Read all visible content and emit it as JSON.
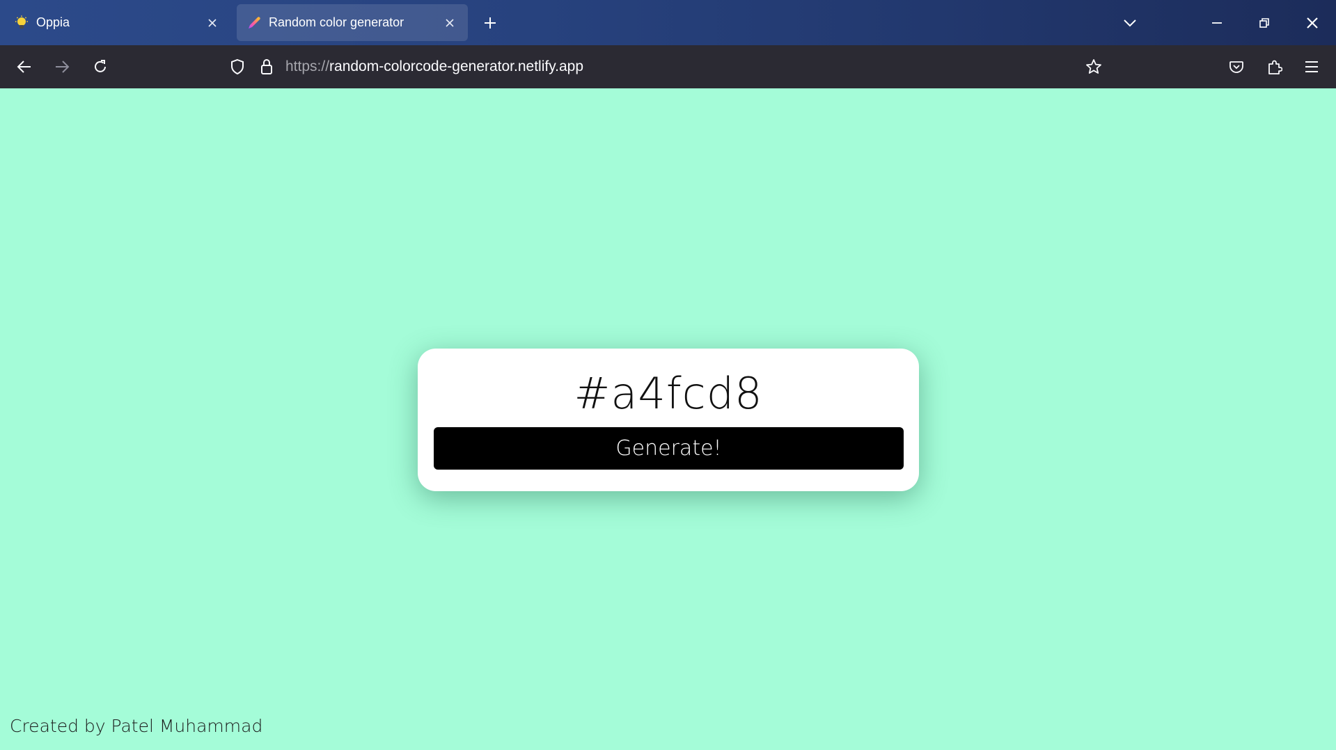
{
  "browser": {
    "tabs": [
      {
        "title": "Oppia",
        "favicon": "lightbulb-icon",
        "active": false
      },
      {
        "title": "Random color generator",
        "favicon": "color-picker-icon",
        "active": true
      }
    ],
    "url_scheme": "https://",
    "url_host": "random-colorcode-generator.netlify.app"
  },
  "page": {
    "background_color": "#a4fcd8",
    "color_code": "#a4fcd8",
    "button_label": "Generate!",
    "credit": "Created by Patel Muhammad"
  }
}
